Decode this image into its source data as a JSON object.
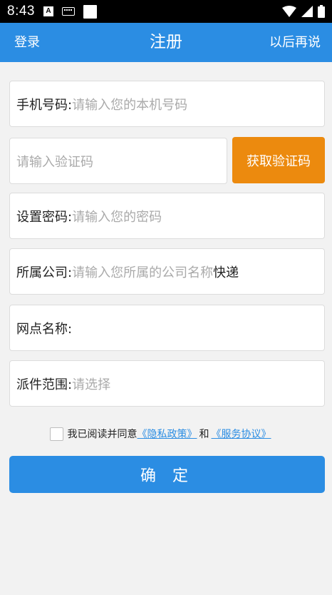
{
  "statusbar": {
    "time": "8:43",
    "a_badge": "A",
    "icons": [
      "notification-a-icon",
      "keyboard-icon",
      "square-icon",
      "wifi-icon",
      "signal-icon",
      "battery-icon"
    ]
  },
  "appbar": {
    "left": "登录",
    "title": "注册",
    "right": "以后再说"
  },
  "form": {
    "phone": {
      "label": "手机号码:",
      "placeholder": "请输入您的本机号码"
    },
    "code": {
      "placeholder": "请输入验证码",
      "button": "获取验证码"
    },
    "password": {
      "label": "设置密码:",
      "placeholder": "请输入您的密码"
    },
    "company": {
      "label": "所属公司:",
      "placeholder": "请输入您所属的公司名称",
      "suffix": "快递"
    },
    "outlet": {
      "label": "网点名称:",
      "value": ""
    },
    "area": {
      "label": "派件范围:",
      "placeholder": "请选择"
    }
  },
  "agreement": {
    "prefix": "我已阅读并同意",
    "privacy": "《隐私政策》",
    "and": "和",
    "service": "《服务协议》",
    "checked": false
  },
  "confirm_label": "确 定",
  "colors": {
    "primary": "#2b8de3",
    "accent": "#ec8a0e",
    "background": "#f2f2f2"
  }
}
